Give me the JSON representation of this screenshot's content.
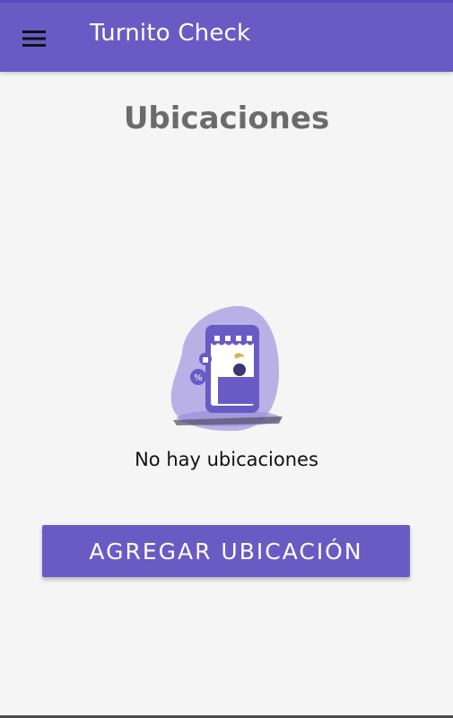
{
  "appbar": {
    "menu_icon": "hamburger-menu-icon",
    "title": "Turnito Check"
  },
  "page": {
    "title": "Ubicaciones",
    "illustration": "empty-store-illustration",
    "empty_message": "No hay ubicaciones"
  },
  "actions": {
    "add_location_label": "AGREGAR UBICACIÓN"
  },
  "colors": {
    "primary": "#6a5ac4",
    "background": "#f5f5f5",
    "title_gray": "#6b6b6b"
  }
}
